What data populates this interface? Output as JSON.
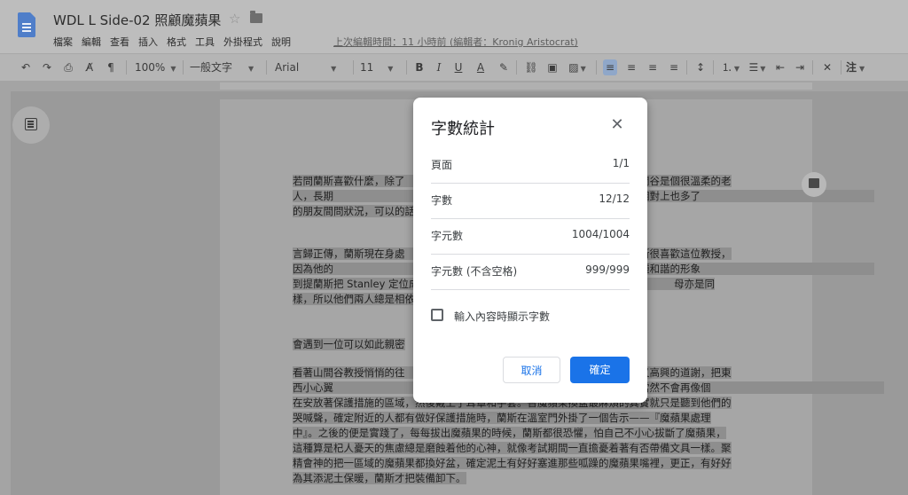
{
  "header": {
    "doc_title": "WDL L Side-02 照顧魔蘋果",
    "menu": [
      "檔案",
      "編輯",
      "查看",
      "插入",
      "格式",
      "工具",
      "外掛程式",
      "說明"
    ],
    "last_edit": "上次編輯時間：11 小時前 (編輯者：Kronig Aristocrat)"
  },
  "toolbar": {
    "zoom": "100%",
    "style": "一般文字",
    "font": "Arial",
    "size": "11",
    "mode": "注"
  },
  "document": {
    "paragraphs": [
      "若問蘭斯喜歡什麼，除了　　　　　　　　　　　　　　　　　一阿索拔・山間谷是個很溫柔的老人，長期　　　　　　　　　　　　　　　　　裡是沒法打電動的，所以蘭斯相對上也多了　　　　　　　　　　　　　　　　　的朋友間問狀況，可以的話，真想晚上溜出",
      "言歸正傳，蘭斯現在身處　　　　　　　　　　　　　　　　　溫室幫忙的蘭斯很喜歡這位教授，因為他的　　　　　　　　　　　　　　　　　雖然待他很好，但就是沒有那種和諧的形象　　　　　　　　　　　　　　　　　到提蘭斯把 Stanley 定位成父親的這件事。然　　　　　　　　　　　　　　　　　母亦是同樣，所以他們兩人總是相依為命，",
      "會遇到一位可以如此親密",
      "看著山間谷教授悄悄的往　　　　　　　　　　　　　　　　　有點不好意思又高興的道謝，把東西小心翼　　　　　　　　　　　　　　　　　已經算是高年級的蘭斯，草浴當然不會再像個　　　　　　　　　　　　　　　　　在安放著保護措施的區域，然後戴上了耳罩和手套。替魔蘋果換盆最麻煩的其實就只是聽到他們的哭喊聲，確定附近的人都有做好保護措施時，蘭斯在溫室門外掛了一個告示——『魔蘋果處理中』。之後的便是實踐了，每每拔出魔蘋果的時候，蘭斯都很恐懼，怕自己不小心拔斷了魔蘋果，這種算是杞人憂天的焦慮總是磨蝕着他的心神，就像考試期間一直擔憂着著有否帶備文具一樣。聚精會神的把一區域的魔蘋果都換好盆，確定泥土有好好塞進那些呱躁的魔蘋果嘴裡，更正，有好好為其添泥土保暖，蘭斯才把裝備卸下。"
    ]
  },
  "dialog": {
    "title": "字數統計",
    "rows": [
      {
        "label": "頁面",
        "value": "1/1"
      },
      {
        "label": "字數",
        "value": "12/12"
      },
      {
        "label": "字元數",
        "value": "1004/1004"
      },
      {
        "label": "字元數 (不含空格)",
        "value": "999/999"
      }
    ],
    "checkbox_label": "輸入內容時顯示字數",
    "cancel_label": "取消",
    "ok_label": "確定"
  }
}
